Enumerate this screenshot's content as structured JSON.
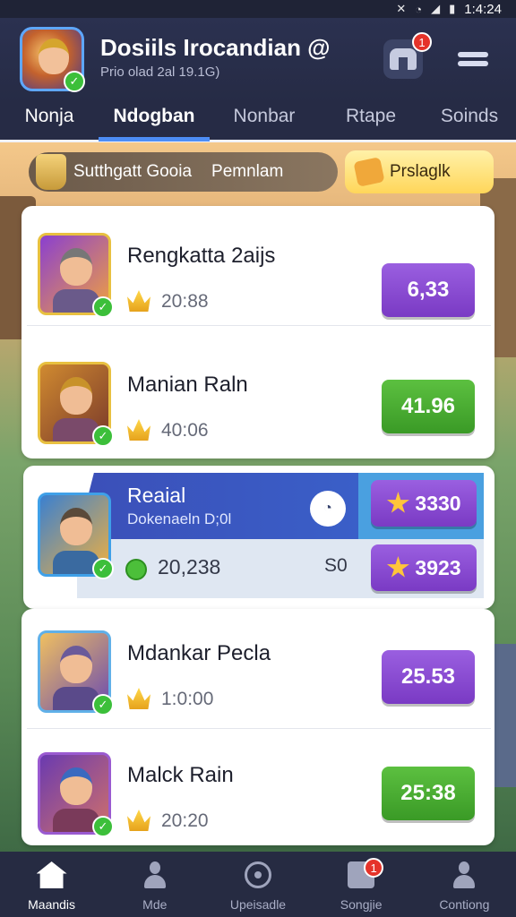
{
  "status_bar": {
    "time": "1:4:24"
  },
  "header": {
    "title": "Dosiils Irocandian @",
    "subtitle": "Prio olad 2al 19.1G)",
    "store_badge": "1"
  },
  "tabs": [
    {
      "label": "Nonja"
    },
    {
      "label": "Ndogban"
    },
    {
      "label": "Nonbar"
    },
    {
      "label": "Rtape"
    },
    {
      "label": "Soinds"
    }
  ],
  "promo": {
    "text1": "Sutthgatt Gooia",
    "text2": "Pemnlam",
    "button": "Prslaglk"
  },
  "items": [
    {
      "name": "Rengkatta 2aijs",
      "time": "20:88",
      "price": "6,33",
      "color": "purple"
    },
    {
      "name": "Manian Raln",
      "time": "40:06",
      "price": "41.96",
      "color": "green"
    }
  ],
  "featured": {
    "title": "Reaial",
    "subtitle": "Dokenaeln D;0l",
    "value": "20,238",
    "small": "S0",
    "btn1": "3330",
    "btn2": "3923"
  },
  "items2": [
    {
      "name": "Mdankar Pecla",
      "time": "1:0:00",
      "price": "25.53",
      "color": "purple"
    },
    {
      "name": "Malck Rain",
      "time": "20:20",
      "price": "25:38",
      "color": "green"
    }
  ],
  "bottom_nav": [
    {
      "label": "Maandis"
    },
    {
      "label": "Mde"
    },
    {
      "label": "Upeisadle"
    },
    {
      "label": "Songjie",
      "badge": "1"
    },
    {
      "label": "Contiong"
    }
  ],
  "colors": {
    "accent_blue": "#4d8df5",
    "purple_button": "#7a3ac4",
    "green_button": "#3a9a26",
    "badge_red": "#e5332a"
  }
}
